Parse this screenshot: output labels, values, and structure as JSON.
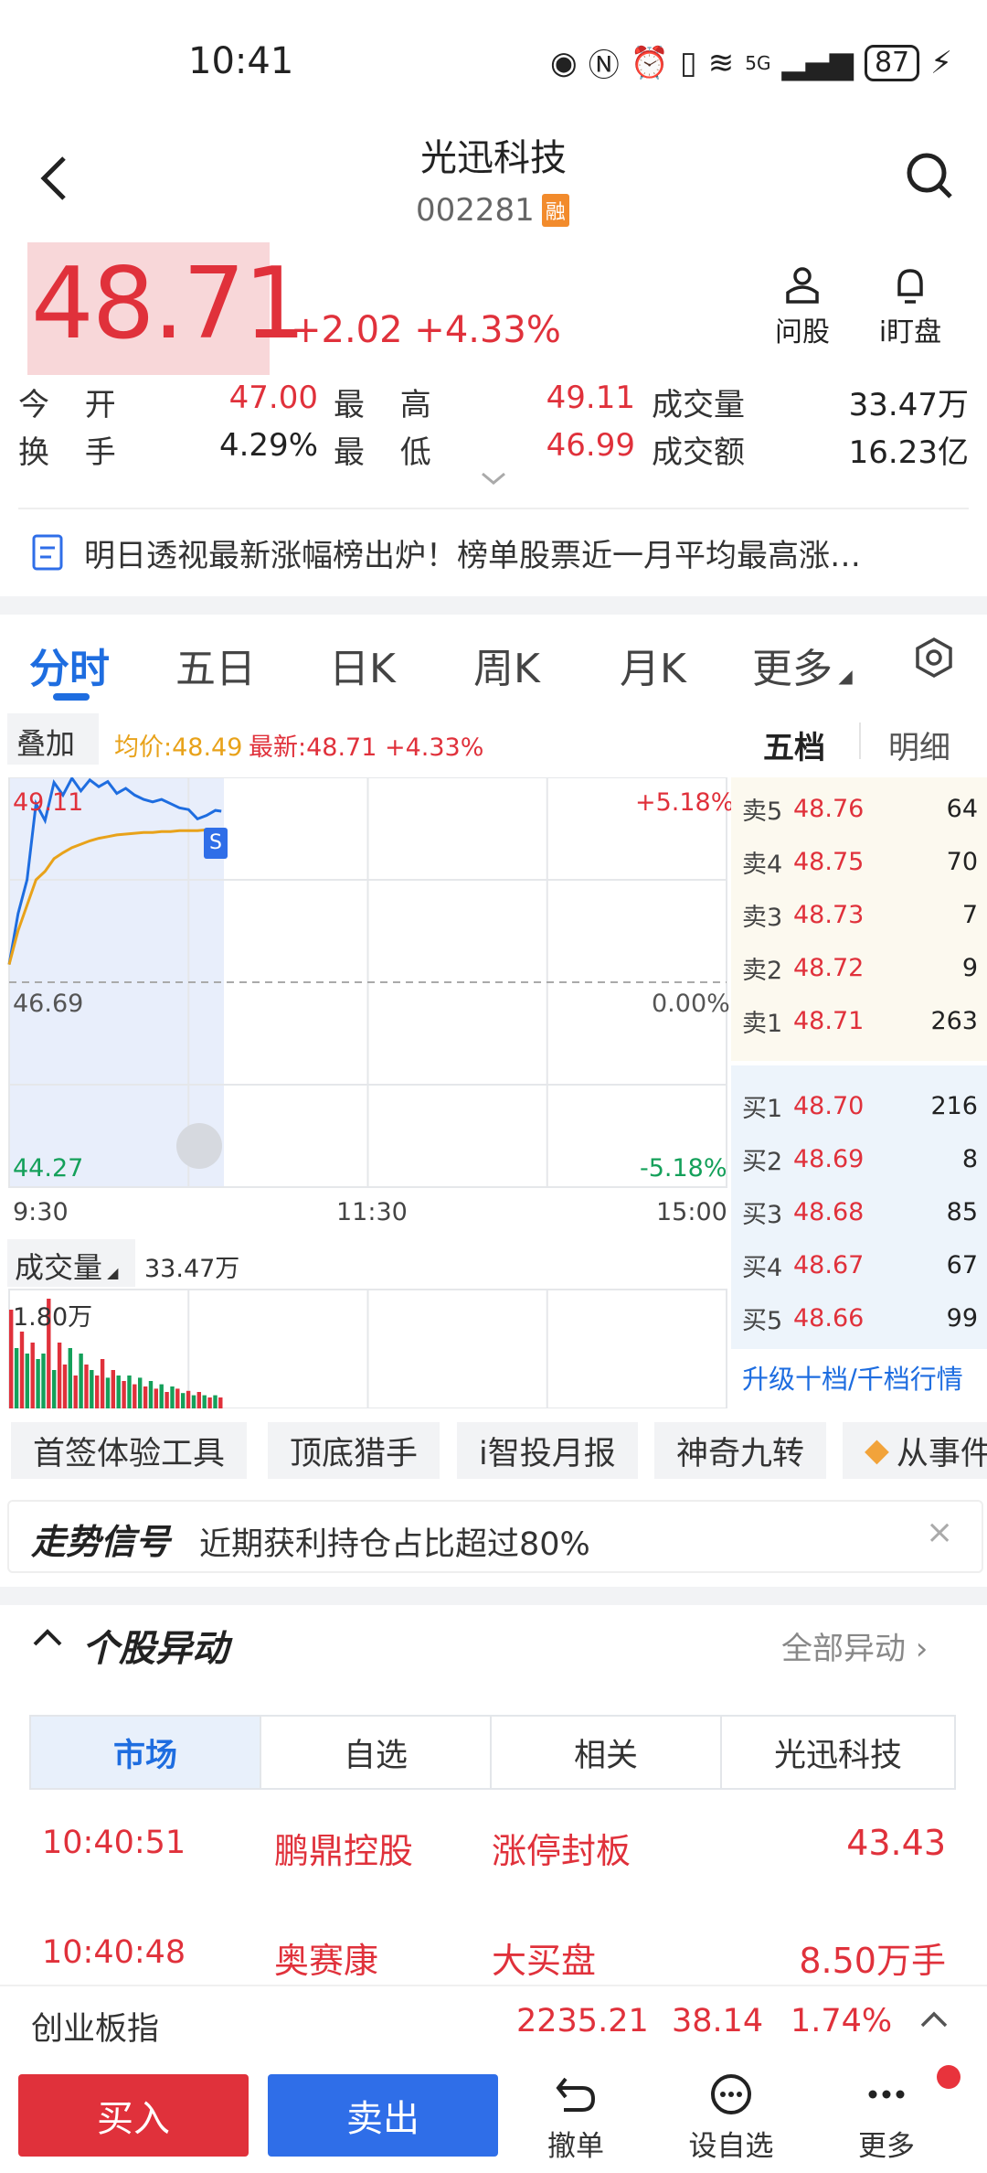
{
  "status": {
    "time": "10:41",
    "battery": "87",
    "network": "5G"
  },
  "header": {
    "title": "光迅科技",
    "code": "002281",
    "margin_badge": "融"
  },
  "price": {
    "current": "48.71",
    "change": "+2.02",
    "change_pct": "+4.33%"
  },
  "quick_actions": [
    {
      "label": "问股",
      "icon": "ask-stock-icon"
    },
    {
      "label": "i盯盘",
      "icon": "bell-icon"
    }
  ],
  "stats": {
    "open_label": "今 开",
    "open": "47.00",
    "high_label": "最 高",
    "high": "49.11",
    "volume_label": "成交量",
    "volume": "33.47万",
    "turnover_label": "换 手",
    "turnover": "4.29%",
    "low_label": "最 低",
    "low": "46.99",
    "amount_label": "成交额",
    "amount": "16.23亿"
  },
  "news": {
    "text": "明日透视最新涨幅榜出炉！榜单股票近一月平均最高涨…"
  },
  "tabs": [
    "分时",
    "五日",
    "日K",
    "周K",
    "月K",
    "更多"
  ],
  "chart_header": {
    "overlay": "叠加",
    "avg": "均价:48.49",
    "latest": "最新:48.71 +4.33%"
  },
  "book_tabs": {
    "five": "五档",
    "detail": "明细"
  },
  "chart_data": {
    "type": "line",
    "title": "",
    "x_ticks": [
      "9:30",
      "11:30",
      "15:00"
    ],
    "y_left_ticks": [
      "49.11",
      "46.69",
      "44.27"
    ],
    "y_right_ticks": [
      "+5.18%",
      "0.00%",
      "-5.18%"
    ],
    "ylim": [
      44.27,
      49.11
    ],
    "prev_close": 46.69,
    "series": [
      {
        "name": "",
        "x": [
          "9:30",
          "9:33",
          "9:36",
          "9:39",
          "9:42",
          "9:45",
          "9:48",
          "9:51",
          "9:54",
          "9:57",
          "10:00",
          "10:03",
          "10:06",
          "10:09",
          "10:12",
          "10:15",
          "10:18",
          "10:21",
          "10:24",
          "10:27",
          "10:30",
          "10:33",
          "10:36",
          "10:39",
          "10:41"
        ],
        "values": [
          46.9,
          47.5,
          47.9,
          48.8,
          48.6,
          49.05,
          48.9,
          49.1,
          48.95,
          49.08,
          49.0,
          49.06,
          48.92,
          48.98,
          48.9,
          48.85,
          48.82,
          48.85,
          48.8,
          48.75,
          48.73,
          48.62,
          48.66,
          48.72,
          48.71
        ]
      },
      {
        "name": "",
        "x": [
          "9:30",
          "9:33",
          "9:36",
          "9:39",
          "9:42",
          "9:45",
          "9:48",
          "9:51",
          "9:54",
          "9:57",
          "10:00",
          "10:03",
          "10:06",
          "10:09",
          "10:12",
          "10:15",
          "10:18",
          "10:21",
          "10:24",
          "10:27",
          "10:30",
          "10:33",
          "10:36",
          "10:39",
          "10:41"
        ],
        "values": [
          46.9,
          47.3,
          47.6,
          47.9,
          48.0,
          48.15,
          48.22,
          48.28,
          48.32,
          48.36,
          48.39,
          48.41,
          48.43,
          48.44,
          48.45,
          48.46,
          48.46,
          48.47,
          48.47,
          48.48,
          48.48,
          48.48,
          48.49,
          48.49,
          48.49
        ]
      }
    ],
    "volume": {
      "label": "成交量",
      "total": "33.47万",
      "ylabel_top": "1.80万",
      "bars": [
        0.9,
        0.55,
        0.7,
        0.5,
        0.6,
        0.45,
        0.5,
        1.0,
        0.35,
        0.6,
        0.4,
        0.55,
        0.3,
        0.5,
        0.4,
        0.35,
        0.3,
        0.45,
        0.28,
        0.35,
        0.3,
        0.25,
        0.3,
        0.22,
        0.28,
        0.2,
        0.25,
        0.18,
        0.22,
        0.15,
        0.2,
        0.18,
        0.14,
        0.16,
        0.12,
        0.15,
        0.12,
        0.1,
        0.12,
        0.1
      ],
      "colors": [
        "red",
        "green",
        "red",
        "green",
        "red",
        "green",
        "green",
        "red",
        "green",
        "red",
        "red",
        "green",
        "red",
        "green",
        "red",
        "green",
        "red",
        "red",
        "green",
        "red",
        "green",
        "red",
        "green",
        "red",
        "green",
        "red",
        "green",
        "red",
        "green",
        "red",
        "green",
        "red",
        "green",
        "red",
        "green",
        "red",
        "green",
        "red",
        "green",
        "red"
      ]
    }
  },
  "order_book": {
    "asks": [
      {
        "label": "卖5",
        "price": "48.76",
        "vol": "64"
      },
      {
        "label": "卖4",
        "price": "48.75",
        "vol": "70"
      },
      {
        "label": "卖3",
        "price": "48.73",
        "vol": "7"
      },
      {
        "label": "卖2",
        "price": "48.72",
        "vol": "9"
      },
      {
        "label": "卖1",
        "price": "48.71",
        "vol": "263"
      }
    ],
    "bids": [
      {
        "label": "买1",
        "price": "48.70",
        "vol": "216"
      },
      {
        "label": "买2",
        "price": "48.69",
        "vol": "8"
      },
      {
        "label": "买3",
        "price": "48.68",
        "vol": "85"
      },
      {
        "label": "买4",
        "price": "48.67",
        "vol": "67"
      },
      {
        "label": "买5",
        "price": "48.66",
        "vol": "99"
      }
    ],
    "upgrade": "升级十档/千档行情"
  },
  "tools": [
    "首签体验工具",
    "顶底猎手",
    "i智投月报",
    "神奇九转",
    "从事件"
  ],
  "signal": {
    "title": "走势信号",
    "text": "近期获利持仓占比超过80%",
    "close": "×"
  },
  "moves": {
    "title": "个股异动",
    "all": "全部异动",
    "segments": [
      "市场",
      "自选",
      "相关",
      "光迅科技"
    ],
    "rows": [
      {
        "time": "10:40:51",
        "stock": "鹏鼎控股",
        "event": "涨停封板",
        "value": "43.43"
      },
      {
        "time": "10:40:48",
        "stock": "奥赛康",
        "event": "大买盘",
        "value": "8.50万手"
      }
    ]
  },
  "index_bar": {
    "name": "创业板指",
    "value": "2235.21",
    "change": "38.14",
    "pct": "1.74%"
  },
  "bottom": {
    "buy": "买入",
    "sell": "卖出",
    "cancel": "撤单",
    "watch": "设自选",
    "more": "更多"
  },
  "colors": {
    "up": "#e0313b",
    "down": "#14a05a",
    "accent": "#1e6de0",
    "avg": "#e8a21a"
  }
}
